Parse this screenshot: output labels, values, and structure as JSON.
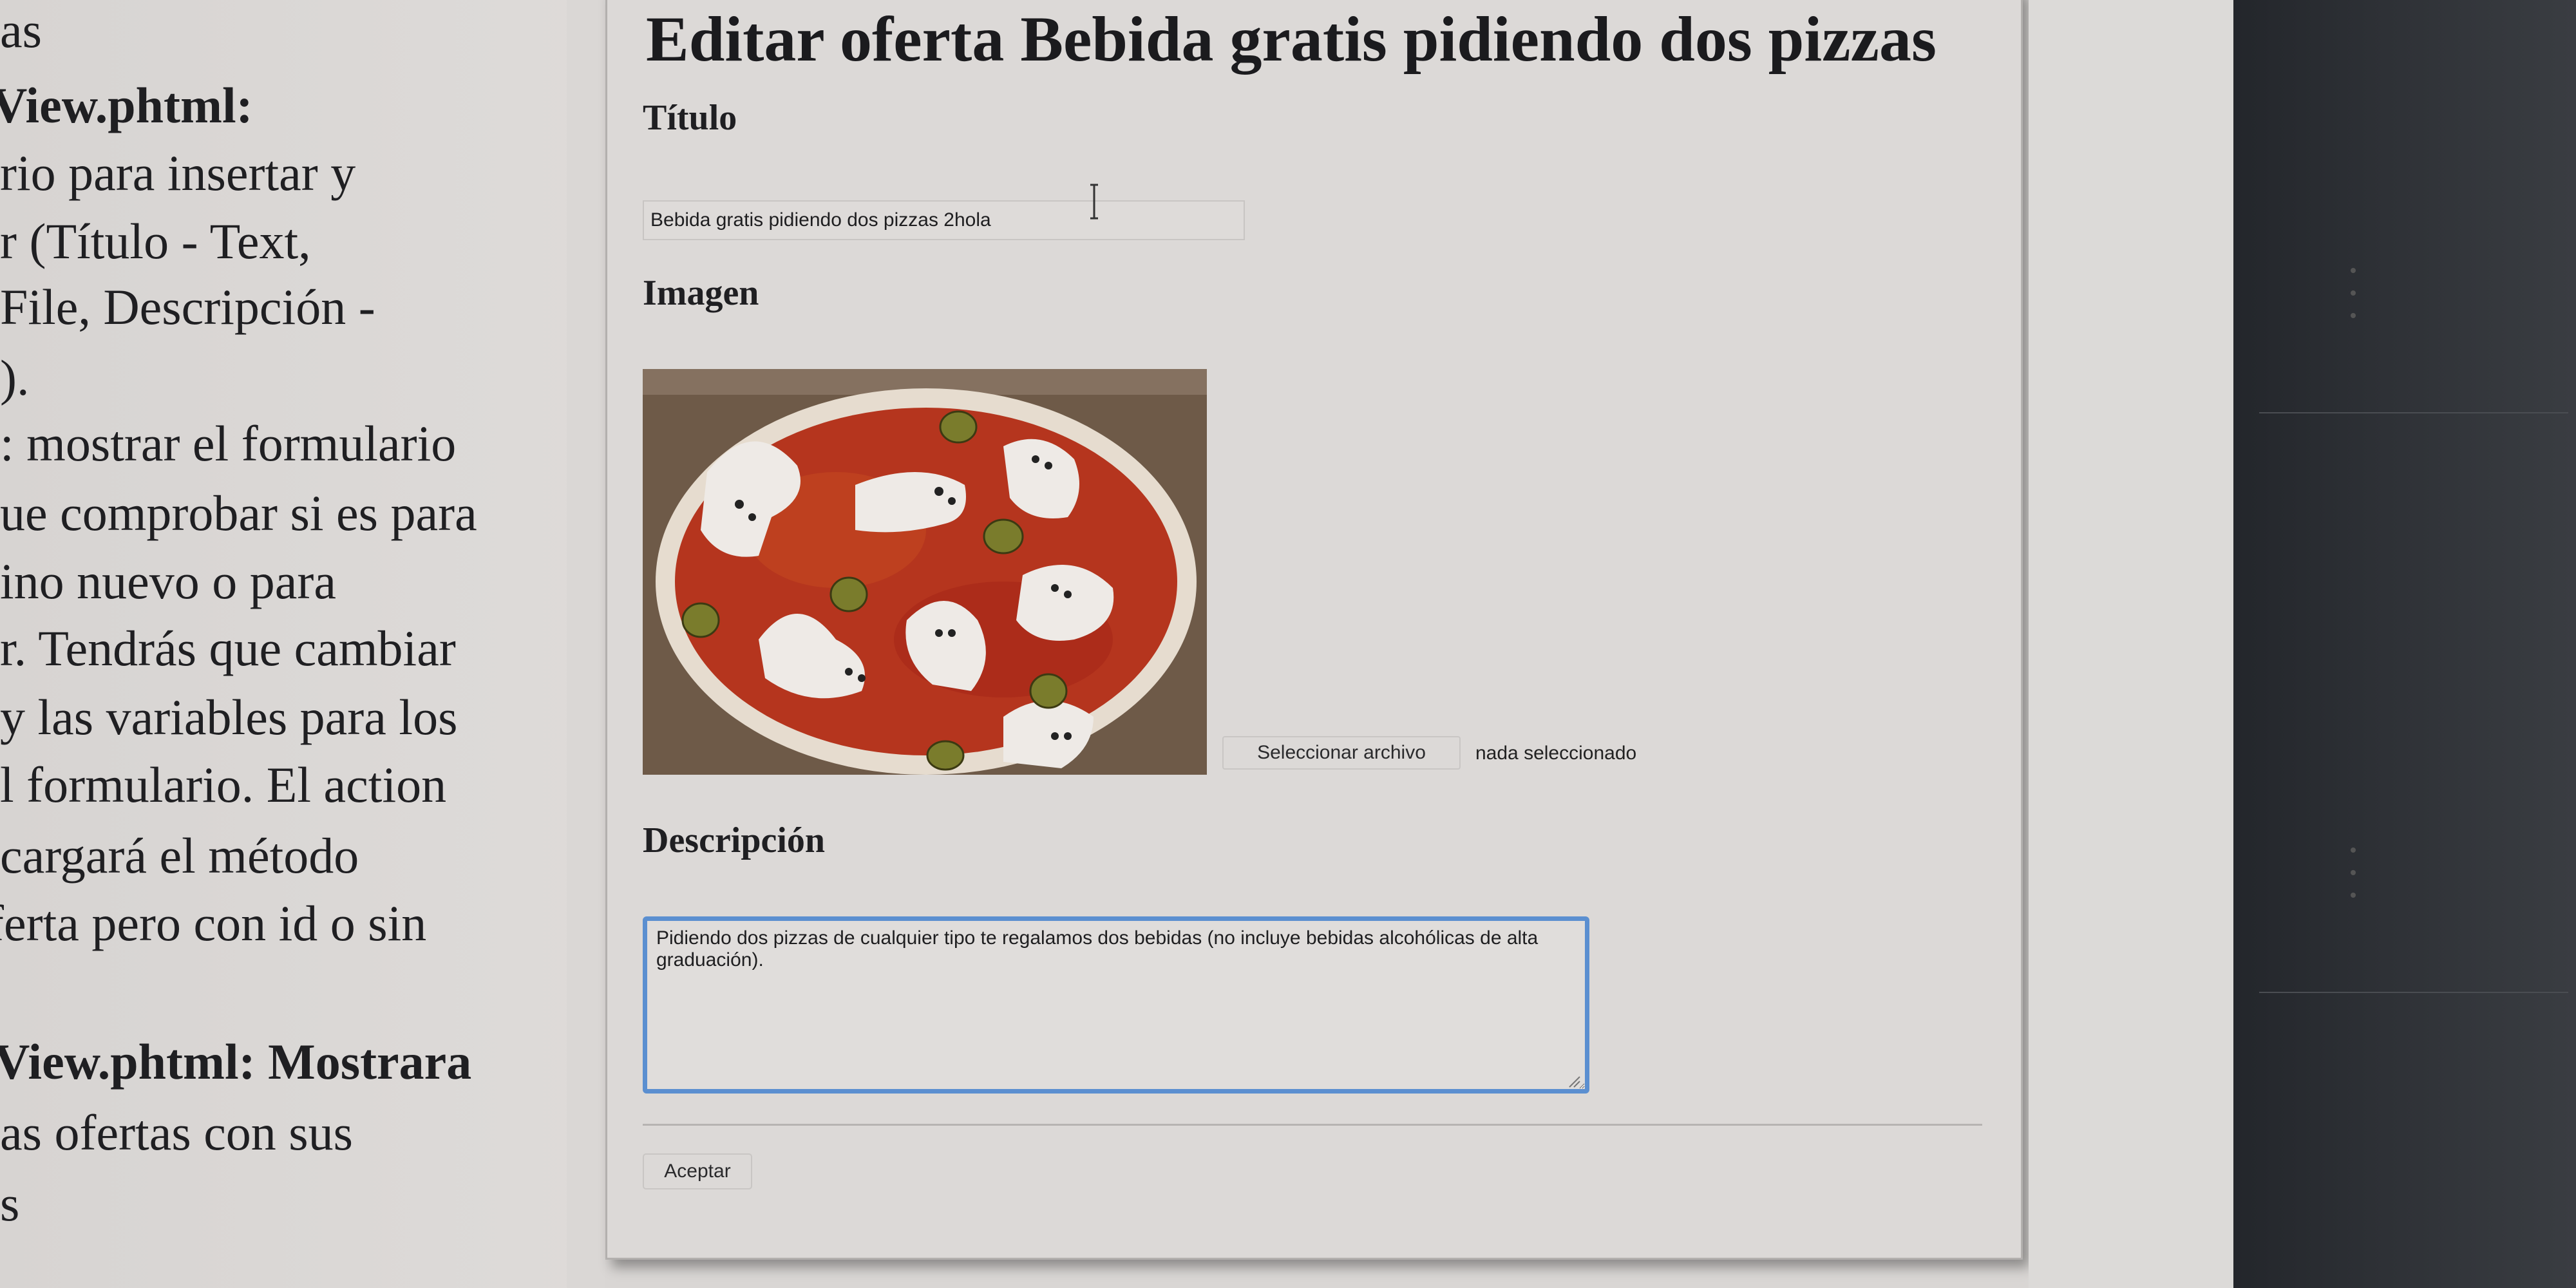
{
  "document": {
    "lines": [
      "as",
      "View.phtml:",
      "rio   para   insertar   y",
      "r   (Título   -   Text,",
      "  File,  Descripción  -",
      ").",
      ": mostrar el formulario",
      "ue comprobar si es para",
      "ino    nuevo    o    para",
      "r. Tendrás que cambiar",
      " y las variables para los",
      "l  formulario.  El  action",
      "  cargará    el    método",
      "ferta pero con id o sin",
      "",
      "View.phtml:   Mostrara",
      "as    ofertas    con    sus",
      "s"
    ]
  },
  "form": {
    "title": "Editar oferta Bebida gratis pidiendo dos pizzas",
    "titulo_label": "Título",
    "titulo_value": "Bebida gratis pidiendo dos pizzas 2hola",
    "imagen_label": "Imagen",
    "file_button_label": "Seleccionar archivo",
    "file_status": "nada seleccionado",
    "descripcion_label": "Descripción",
    "descripcion_value": "Pidiendo dos pizzas de cualquier tipo te regalamos dos bebidas (no incluye bebidas alcohólicas de alta graduación).",
    "accept_label": "Aceptar"
  },
  "colors": {
    "focus_border": "#5b8fd0",
    "panel_bg": "#dcd9d7",
    "dark_bar": "#2d3035"
  }
}
